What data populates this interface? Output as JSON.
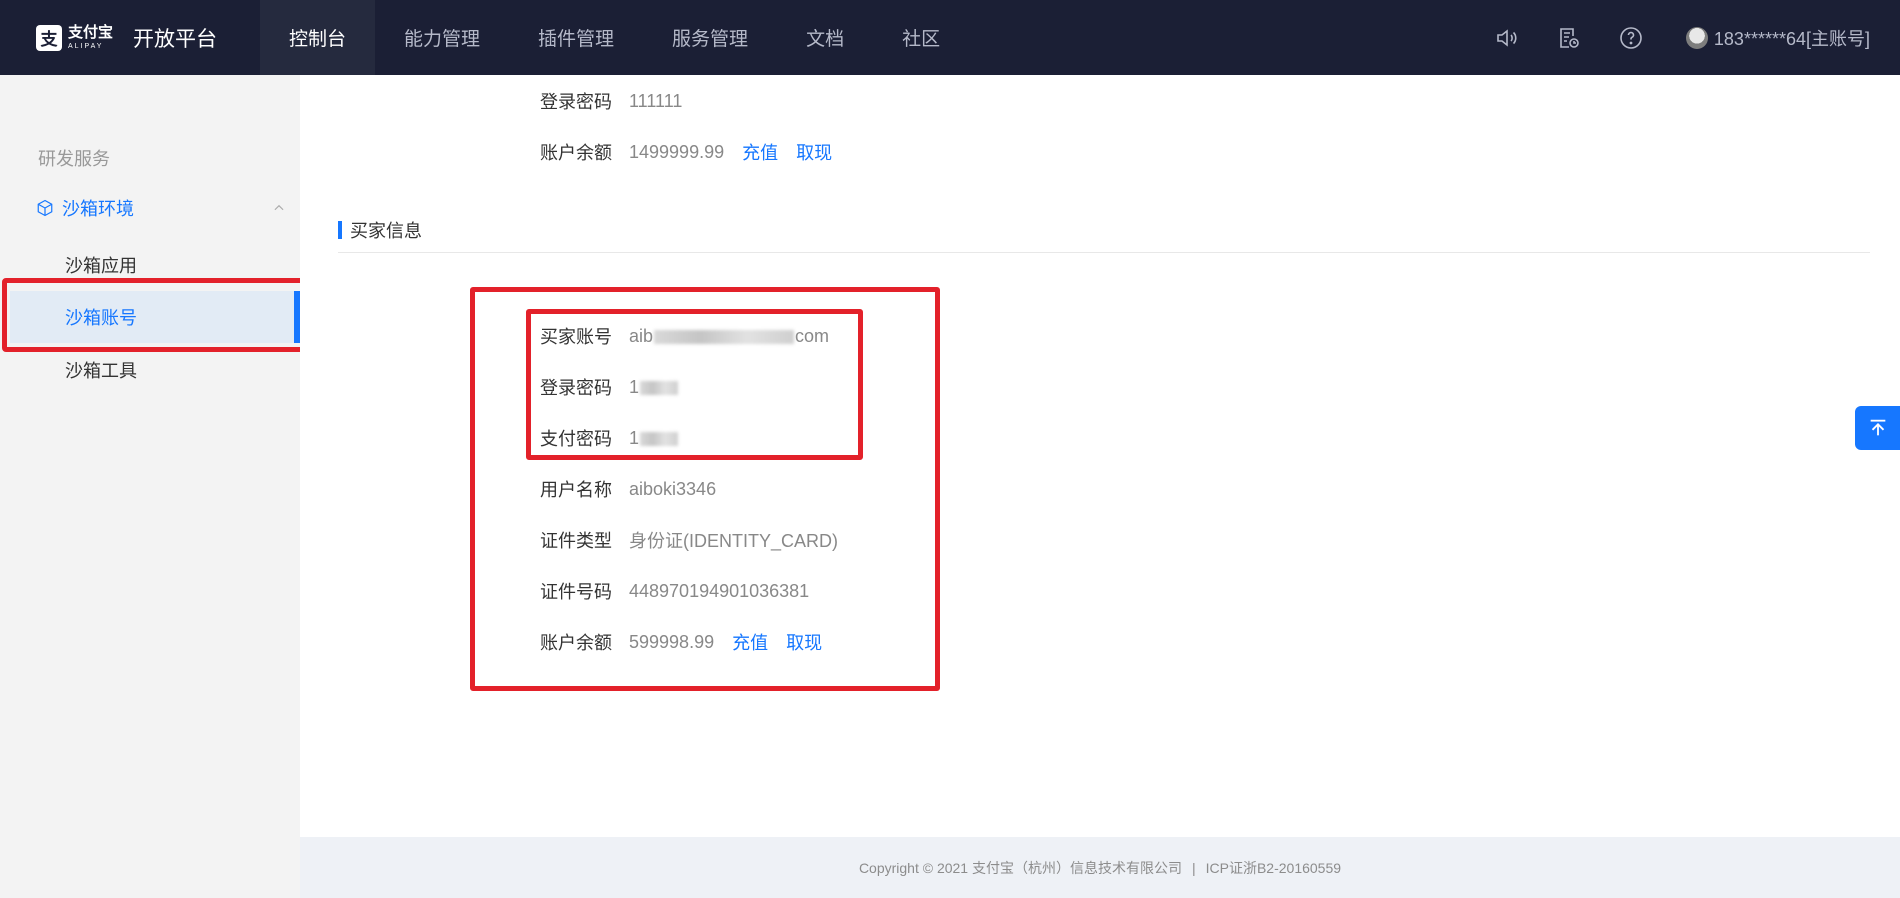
{
  "brand": {
    "logo_mark": "支",
    "logo_cn": "支付宝",
    "logo_en": "ALIPAY",
    "title": "开放平台"
  },
  "nav": {
    "items": [
      {
        "label": "控制台"
      },
      {
        "label": "能力管理"
      },
      {
        "label": "插件管理"
      },
      {
        "label": "服务管理"
      },
      {
        "label": "文档"
      },
      {
        "label": "社区"
      }
    ],
    "active_index": 0
  },
  "topbar": {
    "icons": [
      "speaker-icon",
      "document-clock-icon",
      "help-icon"
    ],
    "user_label": "183******64[主账号]"
  },
  "sidebar": {
    "group_label": "研发服务",
    "section_label": "沙箱环境",
    "items": [
      {
        "label": "沙箱应用"
      },
      {
        "label": "沙箱账号"
      },
      {
        "label": "沙箱工具"
      }
    ],
    "active_index": 1
  },
  "seller": {
    "login_password_label": "登录密码",
    "login_password_value": "111111",
    "balance_label": "账户余额",
    "balance_value": "1499999.99",
    "recharge_label": "充值",
    "withdraw_label": "取现"
  },
  "buyer": {
    "section_title": "买家信息",
    "account_label": "买家账号",
    "account_value_prefix": "aib",
    "account_value_suffix": "com",
    "login_password_label": "登录密码",
    "login_password_prefix": "1",
    "pay_password_label": "支付密码",
    "pay_password_prefix": "1",
    "username_label": "用户名称",
    "username_value": "aiboki3346",
    "id_type_label": "证件类型",
    "id_type_value": "身份证(IDENTITY_CARD)",
    "id_number_label": "证件号码",
    "id_number_value": "448970194901036381",
    "balance_label": "账户余额",
    "balance_value": "599998.99",
    "recharge_label": "充值",
    "withdraw_label": "取现"
  },
  "footer": {
    "copyright": "Copyright © 2021 支付宝（杭州）信息技术有限公司",
    "separator": "|",
    "icp": "ICP证浙B2-20160559"
  },
  "colors": {
    "topbar_bg": "#1b1f35",
    "accent": "#1677ff",
    "highlight_red": "#e3212a",
    "sidebar_bg": "#f3f3f3"
  }
}
